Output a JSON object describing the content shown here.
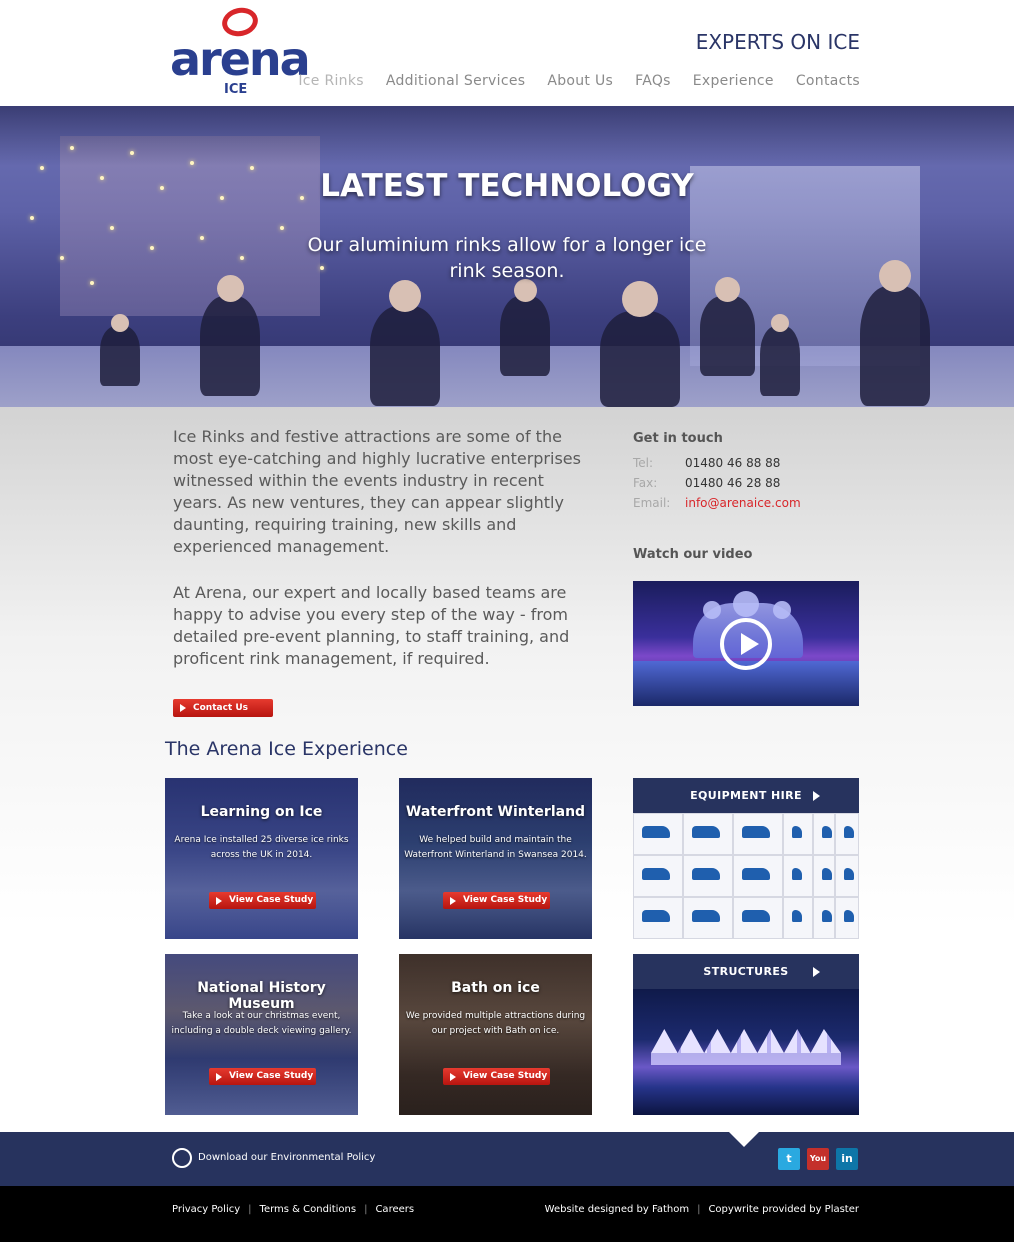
{
  "header": {
    "logo_word": "arena",
    "logo_sub": "ICE",
    "tagline": "EXPERTS ON ICE",
    "nav": [
      "Ice Rinks",
      "Additional Services",
      "About Us",
      "FAQs",
      "Experience",
      "Contacts"
    ]
  },
  "hero": {
    "title": "LATEST TECHNOLOGY",
    "subtitle": "Our aluminium rinks allow for a longer ice rink season."
  },
  "intro": {
    "paragraph1": "Ice Rinks and festive attractions are some of the most eye-catching and highly lucrative enterprises witnessed within the events industry in recent years. As new ventures, they can appear slightly daunting, requiring training, new skills and experienced management.",
    "paragraph2": "At Arena, our expert and locally based teams are happy to advise you every step of the way - from detailed pre-event planning, to staff training, and proficent rink management, if required.",
    "contact_button": "Contact Us"
  },
  "get_in_touch": {
    "title": "Get in touch",
    "tel_label": "Tel:",
    "tel": "01480 46 88 88",
    "fax_label": "Fax:",
    "fax": "01480 46 28 88",
    "email_label": "Email:",
    "email": "info@arenaice.com"
  },
  "video": {
    "title": "Watch our video",
    "icon": "play-icon"
  },
  "experience": {
    "title": "The Arena Ice Experience",
    "cards": [
      {
        "title": "Learning on Ice",
        "desc": "Arena Ice installed 25 diverse ice rinks across the UK in 2014.",
        "button": "View Case Study"
      },
      {
        "title": "Waterfront Winterland",
        "desc": "We helped build and maintain the Waterfront Winterland in Swansea 2014.",
        "button": "View Case Study"
      },
      {
        "title": "National History Museum",
        "desc": "Take a look at our christmas event, including a double deck viewing gallery.",
        "button": "View Case Study"
      },
      {
        "title": "Bath on ice",
        "desc": "We provided multiple attractions during our project with Bath on ice.",
        "button": "View Case Study"
      }
    ],
    "features": [
      {
        "label": "EQUIPMENT HIRE"
      },
      {
        "label": "STRUCTURES"
      }
    ]
  },
  "footer": {
    "env_policy": "Download our Environmental Policy",
    "social": [
      {
        "name": "twitter-icon",
        "glyph": "t",
        "color": "#2aa9e0"
      },
      {
        "name": "youtube-icon",
        "glyph": "You",
        "color": "#c4302b"
      },
      {
        "name": "linkedin-icon",
        "glyph": "in",
        "color": "#0e76a8"
      }
    ],
    "links_left": [
      "Privacy Policy",
      "Terms & Conditions",
      "Careers"
    ],
    "links_right": [
      "Website designed by Fathom",
      "Copywrite provided by Plaster"
    ],
    "separator": "|"
  },
  "colors": {
    "brand_blue": "#2a3f8f",
    "brand_red": "#d8262a",
    "navy": "#27335e"
  }
}
